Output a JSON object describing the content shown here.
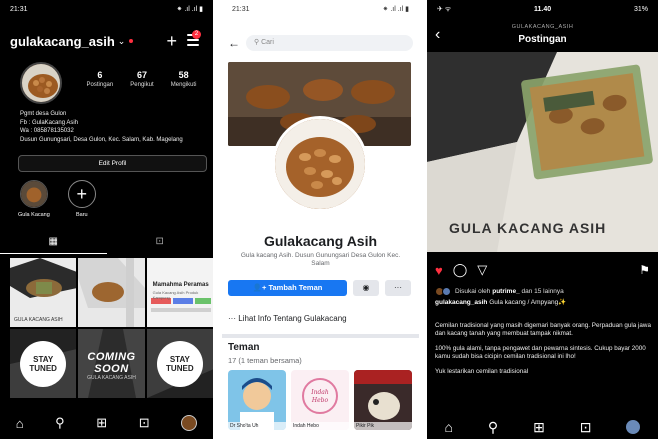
{
  "ig_profile": {
    "time": "21:31",
    "status_icons": "⁕ .ıl .ıl ▮",
    "username": "gulakacang_asih",
    "notif_count": "2",
    "stats": [
      {
        "num": "6",
        "label": "Postingan"
      },
      {
        "num": "67",
        "label": "Pengikut"
      },
      {
        "num": "58",
        "label": "Mengikuti"
      }
    ],
    "bio": [
      "Pgmt desa Gulon",
      "Fb : GulaKacang Asih",
      "Wa : 085878135032",
      "Dusun Gunungsari, Desa Gulon, Kec. Salam, Kab. Magelang"
    ],
    "edit_label": "Edit Profil",
    "highlights": [
      {
        "label": "Gula Kacang"
      },
      {
        "label": "Baru"
      }
    ],
    "grid": {
      "cap1": "GULA KACANG ASIH",
      "menu_title": "Mamahma Peramas",
      "menu_sub": "Gula Kacang Asih Produk Kampung",
      "stay1": "STAY TUNED",
      "coming": "COMING SOON",
      "coming_sub": "GULA KACANG ASIH",
      "stay2": "STAY TUNED"
    }
  },
  "fb_page": {
    "time": "21:31",
    "status_icons": "⁕ .ıl .ıl ▮",
    "search_placeholder": "Cari",
    "name": "Gulakacang Asih",
    "desc": "Gula kacang Asih. Dusun Gunungsari Desa Gulon Kec. Salam",
    "add_friend": "Tambah Teman",
    "info_link": "Lihat Info Tentang Gulakacang",
    "friends_title": "Teman",
    "friends_count": "17 (1 teman bersama)",
    "friends": [
      {
        "name": "Dr Sho'ta Uh"
      },
      {
        "name": "Indah Hebo"
      },
      {
        "name": "Pikir Pik"
      }
    ]
  },
  "ig_post": {
    "time": "11.40",
    "battery": "31%",
    "username_small": "GULAKACANG_ASIH",
    "title": "Postingan",
    "image_text": "GULA KACANG ASIH",
    "liked_by": "Disukai oleh",
    "liked_user": "putrime_",
    "liked_rest": "dan 15 lainnya",
    "caption_user": "gulakacang_asih",
    "caption_text": "Gula kacang / Ampyang✨",
    "paragraphs": [
      "Cemilan tradisional yang masih digemari banyak orang. Perpaduan gula jawa dan kacang tanah yang membuat tampak nikmat.",
      "100% gula alami, tanpa pengawet dan pewarna sintesis. Cukup bayar 2000 kamu sudah bisa cicipin cemilan tradisional ini lho!",
      "Yuk lestarikan cemilan tradisional"
    ]
  }
}
